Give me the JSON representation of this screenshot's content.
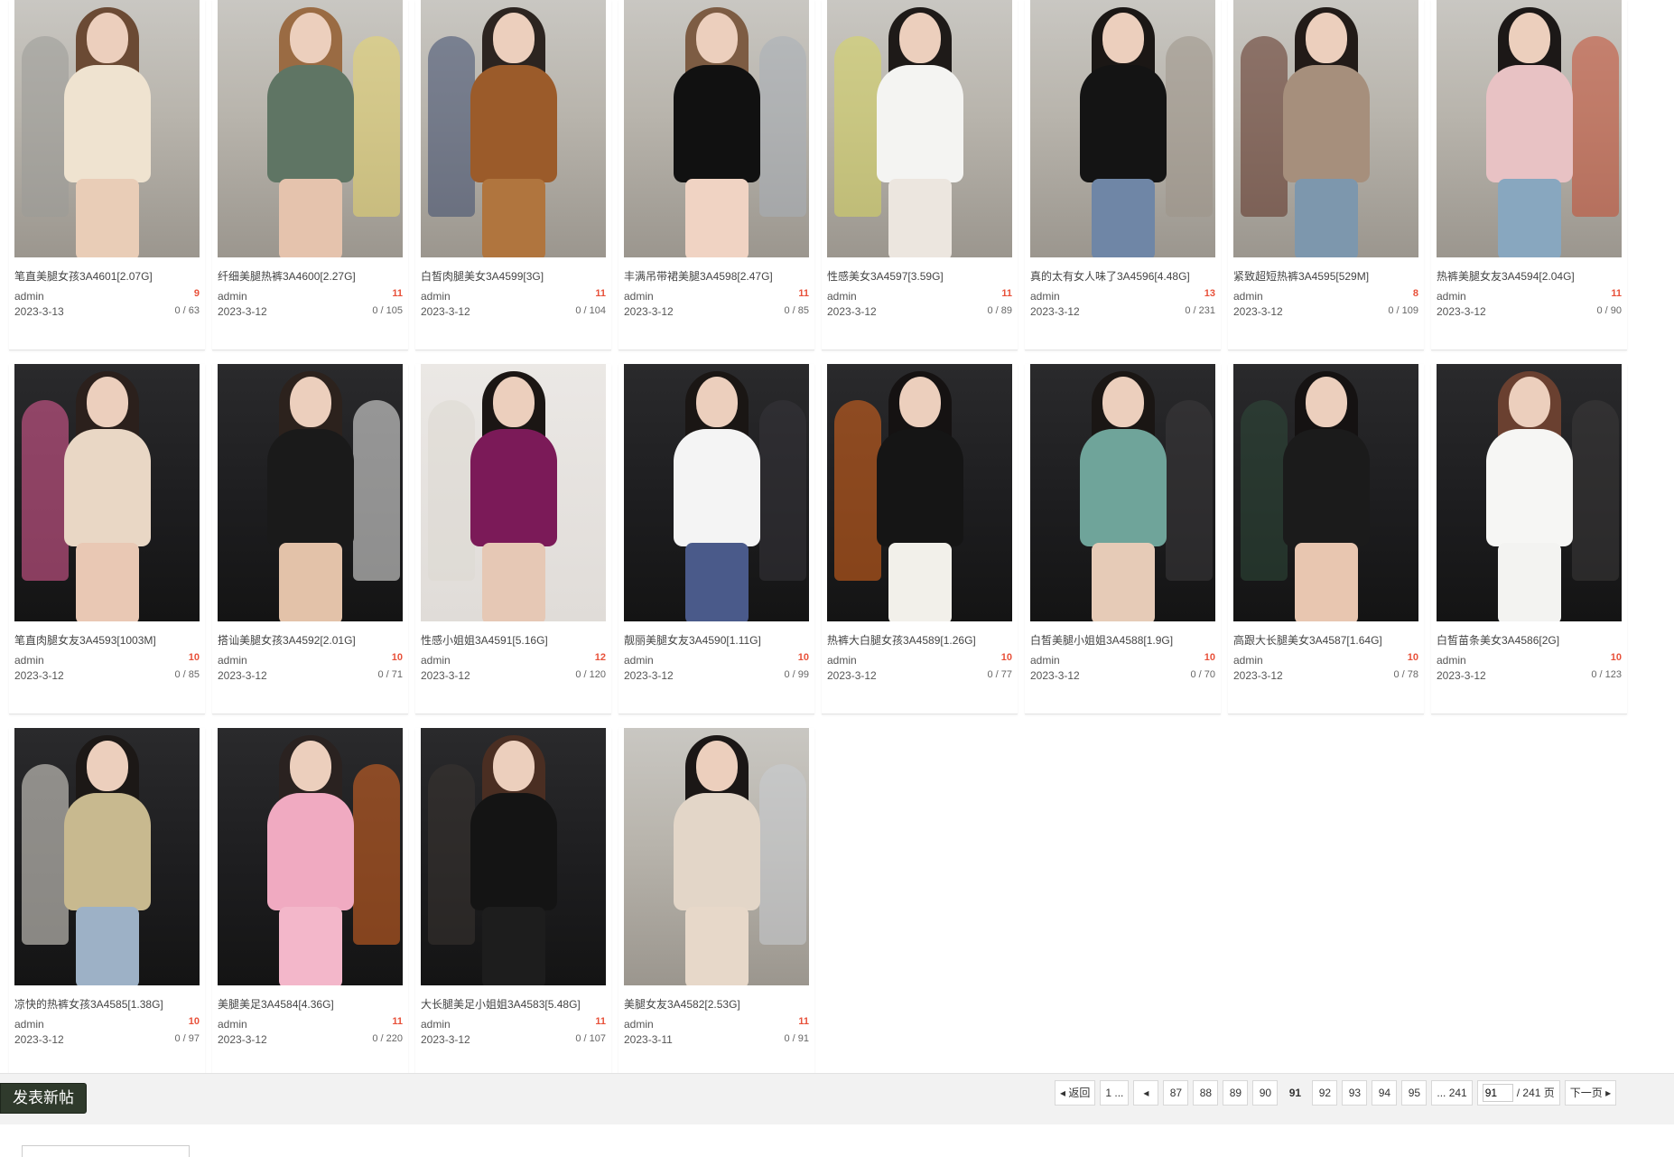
{
  "posts": [
    {
      "title": "笔直美腿女孩3A4601[2.07G]",
      "author": "admin",
      "date": "2023-3-13",
      "replies": "9",
      "views": "0 / 63",
      "scene": "day",
      "top": "#efe3d0",
      "legs": "#e9cdb7",
      "hair": "#6b4a34",
      "bg": "#9a9a97"
    },
    {
      "title": "纤细美腿热裤3A4600[2.27G]",
      "author": "admin",
      "date": "2023-3-12",
      "replies": "11",
      "views": "0 / 105",
      "scene": "day",
      "top": "#5f7564",
      "legs": "#e5c3ad",
      "hair": "#9a6b43",
      "bg": "#e7d66b"
    },
    {
      "title": "白皙肉腿美女3A4599[3G]",
      "author": "admin",
      "date": "2023-3-12",
      "replies": "11",
      "views": "0 / 104",
      "scene": "day",
      "top": "#9b5b2a",
      "legs": "#b0753e",
      "hair": "#2c2420",
      "bg": "#3d4a6d"
    },
    {
      "title": "丰满吊带裙美腿3A4598[2.47G]",
      "author": "admin",
      "date": "2023-3-12",
      "replies": "11",
      "views": "0 / 85",
      "scene": "day",
      "top": "#111111",
      "legs": "#f0d3c3",
      "hair": "#7d5c43",
      "bg": "#a7aeb8"
    },
    {
      "title": "性感美女3A4597[3.59G]",
      "author": "admin",
      "date": "2023-3-12",
      "replies": "11",
      "views": "0 / 89",
      "scene": "day",
      "top": "#f4f4f2",
      "legs": "#ece6df",
      "hair": "#1e1a18",
      "bg": "#d7d65f"
    },
    {
      "title": "真的太有女人味了3A4596[4.48G]",
      "author": "admin",
      "date": "2023-3-12",
      "replies": "13",
      "views": "0 / 231",
      "scene": "day",
      "top": "#141414",
      "legs": "#6f86a6",
      "hair": "#1b1715",
      "bg": "#9c9388"
    },
    {
      "title": "紧致超短热裤3A4595[529M]",
      "author": "admin",
      "date": "2023-3-12",
      "replies": "8",
      "views": "0 / 109",
      "scene": "day",
      "top": "#a68f7c",
      "legs": "#7d97ad",
      "hair": "#221b18",
      "bg": "#5c2f22"
    },
    {
      "title": "热裤美腿女友3A4594[2.04G]",
      "author": "admin",
      "date": "2023-3-12",
      "replies": "11",
      "views": "0 / 90",
      "scene": "day",
      "top": "#e8c2c4",
      "legs": "#88a7bf",
      "hair": "#1c1817",
      "bg": "#c44b2f"
    },
    {
      "title": "笔直肉腿女友3A4593[1003M]",
      "author": "admin",
      "date": "2023-3-12",
      "replies": "10",
      "views": "0 / 85",
      "scene": "night",
      "top": "#e9d7c5",
      "legs": "#e9c8b4",
      "hair": "#2b201c",
      "bg": "#e95f9b"
    },
    {
      "title": "搭讪美腿女孩3A4592[2.01G]",
      "author": "admin",
      "date": "2023-3-12",
      "replies": "10",
      "views": "0 / 71",
      "scene": "night",
      "top": "#1a1a1a",
      "legs": "#e3c2a9",
      "hair": "#2c221d",
      "bg": "#f2f2f0"
    },
    {
      "title": "性感小姐姐3A4591[5.16G]",
      "author": "admin",
      "date": "2023-3-12",
      "replies": "12",
      "views": "0 / 120",
      "scene": "wall",
      "top": "#7b1a58",
      "legs": "#e6c8b5",
      "hair": "#1b1614",
      "bg": "#dcd8d2"
    },
    {
      "title": "靓丽美腿女友3A4590[1.11G]",
      "author": "admin",
      "date": "2023-3-12",
      "replies": "10",
      "views": "0 / 99",
      "scene": "night",
      "top": "#f4f4f4",
      "legs": "#4a5a8a",
      "hair": "#1a1614",
      "bg": "#37343a"
    },
    {
      "title": "热裤大白腿女孩3A4589[1.26G]",
      "author": "admin",
      "date": "2023-3-12",
      "replies": "10",
      "views": "0 / 77",
      "scene": "night",
      "top": "#151515",
      "legs": "#f2f0ea",
      "hair": "#151212",
      "bg": "#e4691e"
    },
    {
      "title": "白皙美腿小姐姐3A4588[1.9G]",
      "author": "admin",
      "date": "2023-3-12",
      "replies": "10",
      "views": "0 / 70",
      "scene": "night",
      "top": "#6fa49a",
      "legs": "#e6cbb7",
      "hair": "#1a1614",
      "bg": "#3c3a3c"
    },
    {
      "title": "高跟大长腿美女3A4587[1.64G]",
      "author": "admin",
      "date": "2023-3-12",
      "replies": "10",
      "views": "0 / 78",
      "scene": "night",
      "top": "#1b1b1b",
      "legs": "#e8c6b0",
      "hair": "#151212",
      "bg": "#2f4a3a"
    },
    {
      "title": "白皙苗条美女3A4586[2G]",
      "author": "admin",
      "date": "2023-3-12",
      "replies": "10",
      "views": "0 / 123",
      "scene": "night",
      "top": "#f6f6f4",
      "legs": "#f3f3f1",
      "hair": "#6a4030",
      "bg": "#3d3b3b"
    },
    {
      "title": "凉快的热裤女孩3A4585[1.38G]",
      "author": "admin",
      "date": "2023-3-12",
      "replies": "10",
      "views": "0 / 97",
      "scene": "night",
      "top": "#c8b98f",
      "legs": "#9db1c6",
      "hair": "#1c1816",
      "bg": "#e9e5dc"
    },
    {
      "title": "美腿美足3A4584[4.36G]",
      "author": "admin",
      "date": "2023-3-12",
      "replies": "11",
      "views": "0 / 220",
      "scene": "night",
      "top": "#f0aac1",
      "legs": "#f3b7ca",
      "hair": "#2a2220",
      "bg": "#e06a24"
    },
    {
      "title": "大长腿美足小姐姐3A4583[5.48G]",
      "author": "admin",
      "date": "2023-3-12",
      "replies": "11",
      "views": "0 / 107",
      "scene": "night",
      "top": "#141414",
      "legs": "#1d1d1d",
      "hair": "#4a2e22",
      "bg": "#3a3431"
    },
    {
      "title": "美腿女友3A4582[2.53G]",
      "author": "admin",
      "date": "2023-3-11",
      "replies": "11",
      "views": "0 / 91",
      "scene": "day",
      "top": "#e3d6c8",
      "legs": "#e7d8c9",
      "hair": "#1b1716",
      "bg": "#c9ccd1"
    }
  ],
  "toolbar": {
    "new_post_label": "发表新帖"
  },
  "pagination": {
    "back_label": "◂ 返回",
    "first_label": "1 ...",
    "prev_label": "◂",
    "pages": [
      "87",
      "88",
      "89",
      "90",
      "91",
      "92",
      "93",
      "94",
      "95"
    ],
    "current": "91",
    "last_label": "... 241",
    "page_input": "91",
    "total_label": "/ 241 页",
    "next_label": "下一页 ▸"
  }
}
